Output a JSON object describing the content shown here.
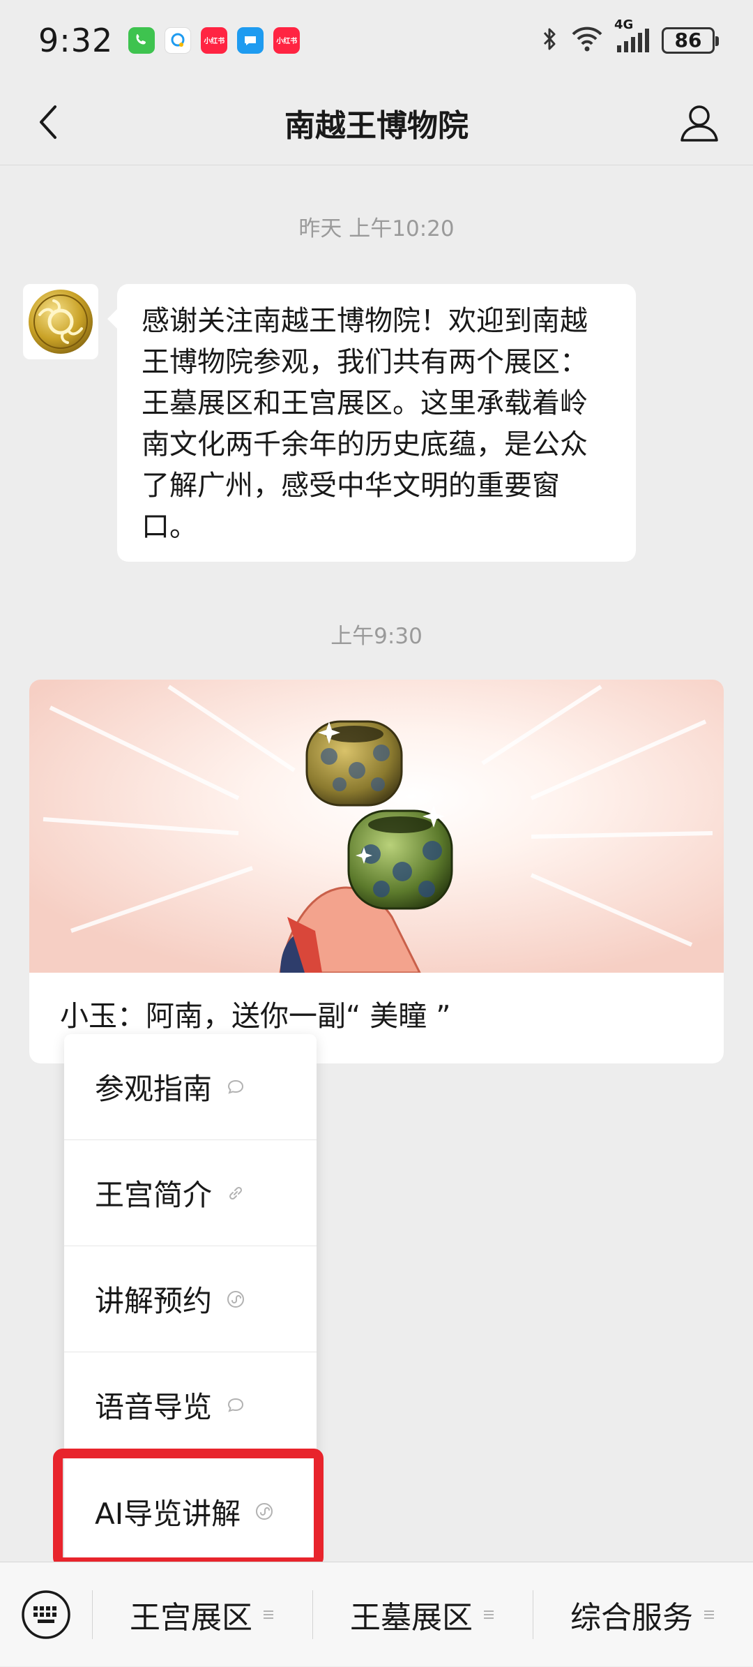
{
  "status_bar": {
    "time": "9:32",
    "network": "4G",
    "battery": "86",
    "app_icons": [
      {
        "name": "phone-app-icon",
        "color": "#3ec34f",
        "label": ""
      },
      {
        "name": "qq-app-icon",
        "color": "#ffffff",
        "label": ""
      },
      {
        "name": "xiaohongshu-app-icon",
        "color": "#ff2442",
        "label": "小红书"
      },
      {
        "name": "message-app-icon",
        "color": "#1e9bf0",
        "label": ""
      },
      {
        "name": "xiaohongshu-app-icon-2",
        "color": "#ff2442",
        "label": "小红书"
      }
    ]
  },
  "header": {
    "title": "南越王博物院"
  },
  "chat": {
    "timestamp_1": "昨天 上午10:20",
    "welcome_message": "感谢关注南越王博物院！欢迎到南越王博物院参观，我们共有两个展区：王墓展区和王宫展区。这里承载着岭南文化两千余年的历史底蕴，是公众了解广州，感受中华文明的重要窗口。",
    "timestamp_2": "上午9:30",
    "card_caption": "小玉：阿南，送你一副“ 美瞳 ”"
  },
  "popup_menu": {
    "items": [
      {
        "label": "参观指南",
        "icon": "message-icon"
      },
      {
        "label": "王宫简介",
        "icon": "link-icon"
      },
      {
        "label": "讲解预约",
        "icon": "mini-program-icon"
      },
      {
        "label": "语音导览",
        "icon": "message-icon"
      },
      {
        "label": "AI导览讲解",
        "icon": "mini-program-icon"
      }
    ]
  },
  "bottom_menu": {
    "tabs": [
      {
        "label": "王宫展区"
      },
      {
        "label": "王墓展区"
      },
      {
        "label": "综合服务"
      }
    ]
  },
  "colors": {
    "background": "#ededed",
    "highlight": "#e8242c"
  }
}
